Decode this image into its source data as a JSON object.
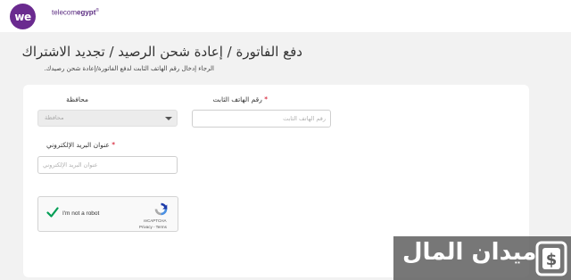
{
  "header": {
    "logo_text": "we",
    "brand_prefix": "telecom",
    "brand_bold": "egypt",
    "brand_mark": "®"
  },
  "page": {
    "title": "دفع الفاتورة / إعادة شحن الرصيد / تجديد الاشتراك",
    "subtitle": "الرجاء إدخال رقم الهاتف الثابت لدفع الفاتورة/إعادة شحن رصيدك."
  },
  "form": {
    "phone": {
      "label": "رقم الهاتف الثابت",
      "required_mark": "*",
      "placeholder": "رقم الهاتف الثابت",
      "value": ""
    },
    "governorate": {
      "label": "محافظة",
      "selected": "محافظة"
    },
    "email": {
      "label": "عنوان البريد الإلكتروني",
      "required_mark": "*",
      "placeholder": "عنوان البريد الإلكتروني",
      "value": ""
    }
  },
  "captcha": {
    "label": "I'm not a robot",
    "brand": "reCAPTCHA",
    "links": "Privacy - Terms",
    "checked": true
  },
  "watermark": {
    "text": "ميدان المال"
  },
  "colors": {
    "brand": "#5c2d82",
    "required": "#d0021b",
    "check": "#009e55",
    "watermark_bg": "#5f5f5f"
  }
}
